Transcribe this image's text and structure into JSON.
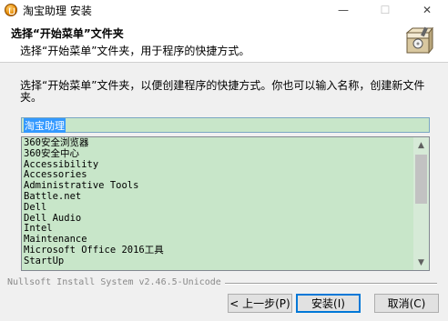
{
  "window": {
    "title": "淘宝助理 安装",
    "minimize_glyph": "—",
    "maximize_glyph": "☐",
    "close_glyph": "✕"
  },
  "header": {
    "title": "选择“开始菜单”文件夹",
    "subtitle": "选择“开始菜单”文件夹，用于程序的快捷方式。",
    "icon": "installer-box-icon"
  },
  "body": {
    "description": "选择“开始菜单”文件夹，以便创建程序的快捷方式。你也可以输入名称，创建新文件夹。",
    "folder_input_value": "淘宝助理",
    "folders": [
      "360安全浏览器",
      "360安全中心",
      "Accessibility",
      "Accessories",
      "Administrative Tools",
      "Battle.net",
      "Dell",
      "Dell Audio",
      "Intel",
      "Maintenance",
      "Microsoft Office 2016工具",
      "StartUp"
    ],
    "scroll_up_glyph": "▲",
    "scroll_down_glyph": "▼"
  },
  "branding": {
    "text": "Nullsoft Install System v2.46.5-Unicode"
  },
  "buttons": {
    "back": "< 上一步(P)",
    "install": "安装(I)",
    "cancel": "取消(C)"
  },
  "colors": {
    "list_background": "#c8e6c9",
    "selection": "#3399ff",
    "default_button_border": "#0078d7"
  }
}
